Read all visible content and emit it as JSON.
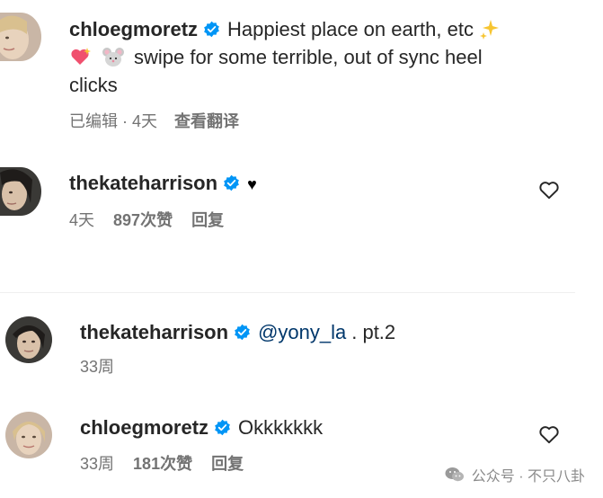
{
  "comments": [
    {
      "username": "chloegmoretz",
      "text_line1": "Happiest place on earth, etc",
      "text_line2": "swipe for some terrible, out of sync heel",
      "text_line3": "clicks",
      "edited": "已编辑 · 4天",
      "translate": "查看翻译",
      "sparkle_icon": "sparkles-icon",
      "heart_icon": "sparkling-heart-icon",
      "mouse_icon": "mouse-face-icon"
    },
    {
      "username": "thekateharrison",
      "text": "♥",
      "time": "4天",
      "likes": "897次赞",
      "reply": "回复"
    },
    {
      "username": "thekateharrison",
      "mention": "@yony_la",
      "text": ". pt.2",
      "time": "33周"
    },
    {
      "username": "chloegmoretz",
      "text": "Okkkkkkk",
      "time": "33周",
      "likes": "181次赞",
      "reply": "回复"
    }
  ],
  "watermark": {
    "text": "公众号 · 不只八卦",
    "icon": "wechat-icon"
  },
  "colors": {
    "text": "#262626",
    "meta": "#737373",
    "verified": "#0095f6",
    "mention": "#00376b"
  }
}
